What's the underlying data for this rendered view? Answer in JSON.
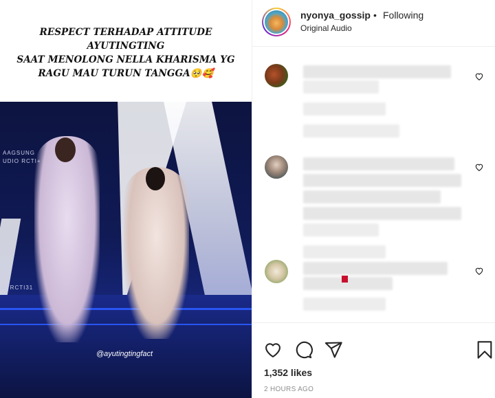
{
  "post": {
    "caption_line1": "RESPECT TERHADAP ATTITUDE AYUTINGTING",
    "caption_line2": "SAAT MENOLONG NELLA KHARISMA YG",
    "caption_line3": "RAGU MAU TURUN TANGGA🥺🥰",
    "video_overlay_left": "AAGSUNG",
    "video_overlay_left2": "UDIO RCTI+",
    "video_overlay_bottom": "UTRCTI31",
    "watermark": "@ayutingtingfact"
  },
  "header": {
    "username": "nyonya_gossip",
    "separator": "•",
    "follow_status": "Following",
    "audio_label": "Original Audio"
  },
  "actions": {
    "icons": [
      "heart-icon",
      "comment-icon",
      "share-icon",
      "bookmark-icon"
    ],
    "likes_text": "1,352 likes",
    "time_text": "2 HOURS AGO"
  },
  "colors": {
    "text": "#262626",
    "muted": "#8e8e8e",
    "border": "#efefef"
  }
}
